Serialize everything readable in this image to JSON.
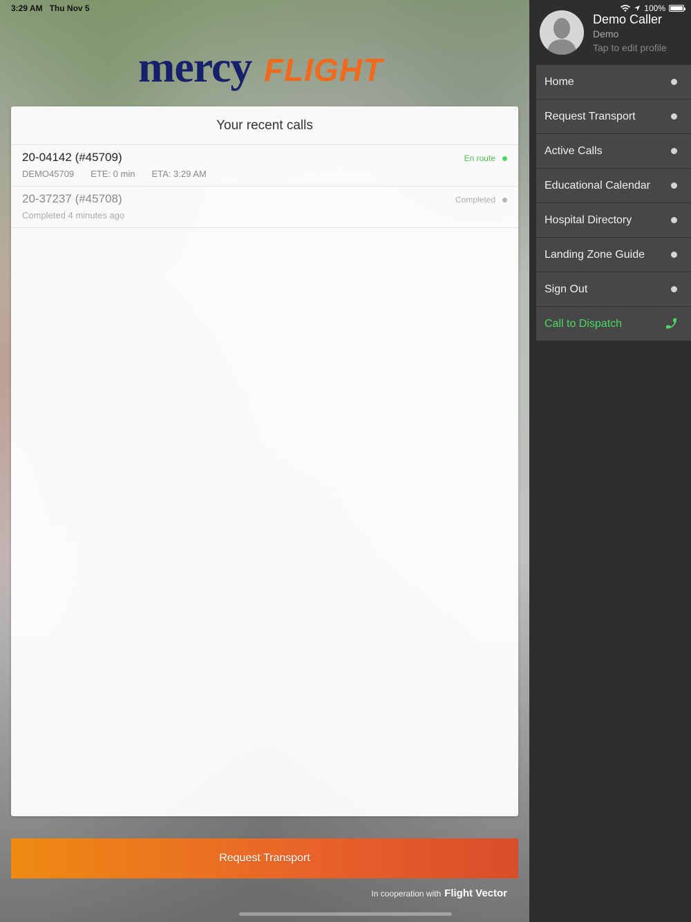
{
  "status_bar": {
    "time": "3:29 AM",
    "date": "Thu Nov 5",
    "battery": "100%"
  },
  "logo": {
    "part1": "mercy",
    "part2": "FLIGHT"
  },
  "recent_calls": {
    "title": "Your recent calls",
    "calls": [
      {
        "title": "20-04142 (#45709)",
        "subtitle_parts": [
          "DEMO45709",
          "ETE: 0 min",
          "ETA: 3:29 AM"
        ],
        "status": "En route"
      },
      {
        "title": "20-37237 (#45708)",
        "subtitle_parts": [
          "Completed 4 minutes ago"
        ],
        "status": "Completed"
      }
    ]
  },
  "request_button": "Request Transport",
  "cooperation": {
    "prefix": "In cooperation with",
    "brand": "Flight Vector"
  },
  "profile": {
    "name": "Demo Caller",
    "role": "Demo",
    "edit_hint": "Tap to edit profile"
  },
  "menu": [
    "Home",
    "Request Transport",
    "Active Calls",
    "Educational Calendar",
    "Hospital Directory",
    "Landing Zone Guide",
    "Sign Out"
  ],
  "dispatch": "Call to Dispatch",
  "colors": {
    "accent_orange": "#ef6a1d",
    "brand_navy": "#17206a",
    "status_green": "#4cd964",
    "sidebar_bg": "#2e2e2e",
    "menu_item_bg": "#474747"
  }
}
